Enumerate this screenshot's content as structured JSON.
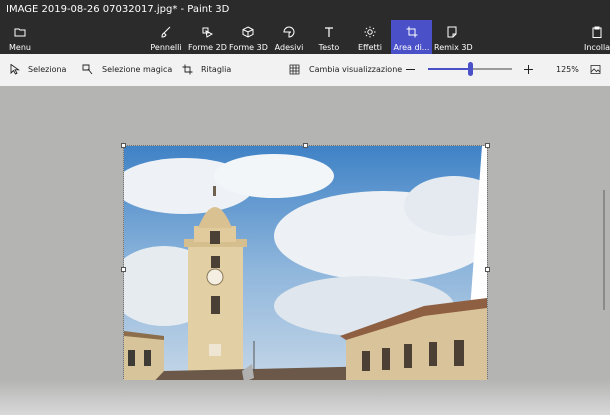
{
  "window": {
    "title": "IMAGE 2019-08-26 07032017.jpg* - Paint 3D"
  },
  "ribbon": {
    "menu": "Menu",
    "tools": [
      "Pennelli",
      "Forme 2D",
      "Forme 3D",
      "Adesivi",
      "Testo",
      "Effetti",
      "Area di...",
      "Remix 3D"
    ],
    "active_tool": "Area di...",
    "paste": "Incolla"
  },
  "toolbar": {
    "select": "Seleziona",
    "magic_select": "Selezione magica",
    "crop": "Ritaglia",
    "change_view": "Cambia visualizzazione",
    "zoom_level": "125%",
    "zoom_slider_value": 0.5
  },
  "colors": {
    "accent": "#4a50c8",
    "ribbon_bg": "#2b2b2b",
    "toolbar_bg": "#f2f2f2",
    "workspace_bg": "#b4b5b3"
  },
  "canvas": {
    "image_description_icon": "photo-clock-tower"
  }
}
